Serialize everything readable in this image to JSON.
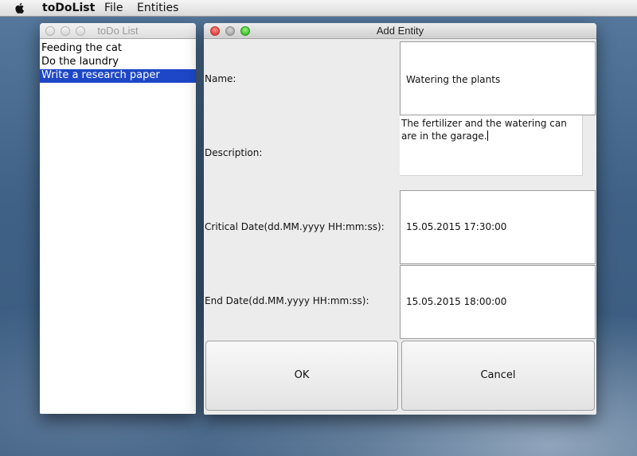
{
  "menubar": {
    "apple_icon": "apple-logo-icon",
    "app_name": "toDoList",
    "file": "File",
    "entities": "Entities"
  },
  "list_window": {
    "title": "toDo List",
    "items": [
      {
        "label": "Feeding the cat",
        "selected": false
      },
      {
        "label": "Do the laundry",
        "selected": false
      },
      {
        "label": "Write a research paper",
        "selected": true
      }
    ]
  },
  "dialog": {
    "title": "Add Entity",
    "fields": {
      "name": {
        "label": "Name:",
        "value": "Watering the plants"
      },
      "description": {
        "label": "Description:",
        "line1": "The fertilizer and the watering can",
        "line2": "are in the garage."
      },
      "critical_date": {
        "label": "Critical Date(dd.MM.yyyy HH:mm:ss):",
        "value": "15.05.2015 17:30:00"
      },
      "end_date": {
        "label": "End Date(dd.MM.yyyy HH:mm:ss):",
        "value": "15.05.2015 18:00:00"
      }
    },
    "ok_label": "OK",
    "cancel_label": "Cancel"
  },
  "colors": {
    "selection": "#1d47c6",
    "close": "#e0443e",
    "zoom": "#3fbf2c"
  }
}
